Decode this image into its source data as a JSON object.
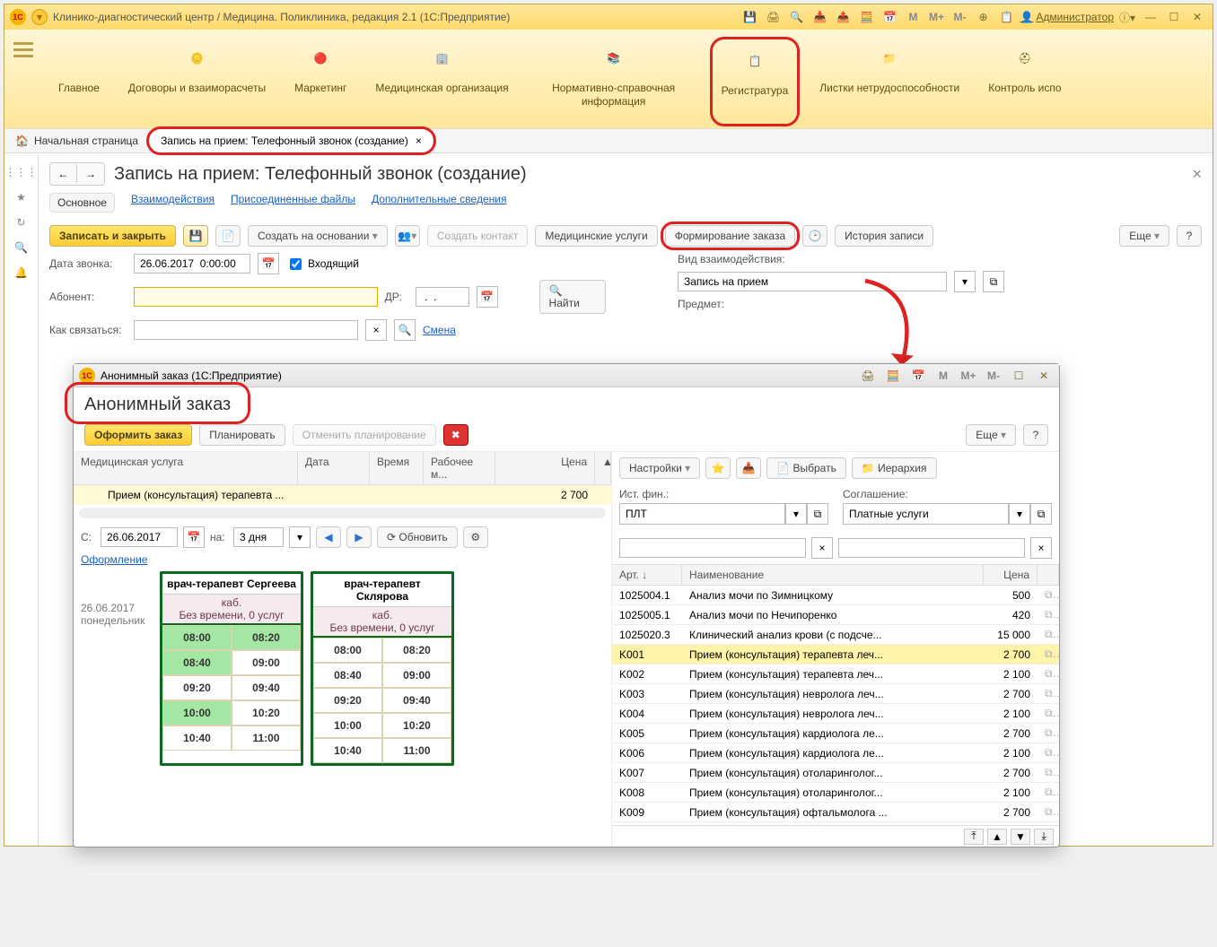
{
  "title": "Клинико-диагностический центр / Медицина. Поликлиника, редакция 2.1  (1С:Предприятие)",
  "admin": "Администратор",
  "nav": {
    "items": [
      {
        "label": "Главное"
      },
      {
        "label": "Договоры и взаиморасчеты"
      },
      {
        "label": "Маркетинг"
      },
      {
        "label": "Медицинская организация"
      },
      {
        "label": "Нормативно-справочная информация"
      },
      {
        "label": "Регистратура"
      },
      {
        "label": "Листки нетрудоспособности"
      },
      {
        "label": "Контроль испо"
      }
    ]
  },
  "tabs": {
    "home": "Начальная страница",
    "active": "Запись на прием: Телефонный звонок (создание)"
  },
  "page": {
    "title": "Запись на прием: Телефонный звонок (создание)",
    "links": {
      "main": "Основное",
      "interactions": "Взаимодействия",
      "files": "Присоединенные файлы",
      "extra": "Дополнительные сведения"
    },
    "buttons": {
      "save": "Записать и закрыть",
      "createBased": "Создать на основании",
      "createContact": "Создать контакт",
      "medServices": "Медицинские услуги",
      "formOrder": "Формирование заказа",
      "history": "История записи",
      "more": "Еще"
    },
    "fields": {
      "dateLabel": "Дата звонка:",
      "dateValue": "26.06.2017  0:00:00",
      "incoming": "Входящий",
      "abonentLabel": "Абонент:",
      "abonent": "",
      "drLabel": "ДР:",
      "drValue": " .  .   ",
      "findLabel": "Найти",
      "contactLabel": "Как связаться:",
      "smena": "Смена",
      "typeLabel": "Вид взаимодействия:",
      "typeValue": "Запись на прием",
      "subjectLabel": "Предмет:"
    }
  },
  "inner": {
    "title": "Анонимный заказ  (1С:Предприятие)",
    "heading": "Анонимный заказ",
    "buttons": {
      "submit": "Оформить заказ",
      "plan": "Планировать",
      "cancel": "Отменить планирование",
      "more": "Еще"
    },
    "grid": {
      "h1": "Медицинская услуга",
      "h2": "Дата",
      "h3": "Время",
      "h4": "Рабочее м...",
      "h5": "Цена",
      "row": {
        "name": "Прием (консультация) терапевта ...",
        "price": "2 700"
      }
    },
    "sched": {
      "cLabel": "С:",
      "cDate": "26.06.2017",
      "naLabel": "на:",
      "naVal": "3 дня",
      "refresh": "Обновить",
      "design": "Оформление",
      "day": "26.06.2017",
      "dayName": "понедельник",
      "doc1": "врач-терапевт Сергеева",
      "doc2": "врач-терапевт Склярова",
      "cabLine": "каб.",
      "statusLine": "Без времени, 0 услуг",
      "slots1": [
        [
          "08:00",
          "08:20"
        ],
        [
          "08:40",
          "09:00"
        ],
        [
          "09:20",
          "09:40"
        ],
        [
          "10:00",
          "10:20"
        ],
        [
          "10:40",
          "11:00"
        ]
      ],
      "slots1green": [
        "08:00",
        "08:20",
        "08:40",
        "10:00"
      ],
      "slots2": [
        [
          "08:00",
          "08:20"
        ],
        [
          "08:40",
          "09:00"
        ],
        [
          "09:20",
          "09:40"
        ],
        [
          "10:00",
          "10:20"
        ],
        [
          "10:40",
          "11:00"
        ]
      ]
    },
    "right": {
      "settings": "Настройки",
      "select": "Выбрать",
      "hierarchy": "Иерархия",
      "srcFinLabel": "Ист. фин.:",
      "srcFin": "ПЛТ",
      "agreeLabel": "Соглашение:",
      "agree": "Платные услуги",
      "cols": {
        "art": "Арт.",
        "name": "Наименование",
        "price": "Цена"
      },
      "rows": [
        {
          "art": "1025004.1",
          "name": "Анализ мочи по Зимницкому",
          "price": "500"
        },
        {
          "art": "1025005.1",
          "name": "Анализ мочи по Нечипоренко",
          "price": "420"
        },
        {
          "art": "1025020.3",
          "name": "Клинический анализ крови (с подсче...",
          "price": "15 000"
        },
        {
          "art": "K001",
          "name": "Прием (консультация) терапевта леч...",
          "price": "2 700",
          "sel": true
        },
        {
          "art": "K002",
          "name": "Прием (консультация) терапевта леч...",
          "price": "2 100"
        },
        {
          "art": "K003",
          "name": "Прием (консультация) невролога леч...",
          "price": "2 700"
        },
        {
          "art": "K004",
          "name": "Прием (консультация) невролога леч...",
          "price": "2 100"
        },
        {
          "art": "K005",
          "name": "Прием (консультация) кардиолога ле...",
          "price": "2 700"
        },
        {
          "art": "K006",
          "name": "Прием (консультация) кардиолога ле...",
          "price": "2 100"
        },
        {
          "art": "K007",
          "name": "Прием (консультация) отоларинголог...",
          "price": "2 700"
        },
        {
          "art": "K008",
          "name": "Прием (консультация) отоларинголог...",
          "price": "2 100"
        },
        {
          "art": "K009",
          "name": "Прием (консультация) офтальмолога ...",
          "price": "2 700"
        }
      ]
    }
  },
  "calc": {
    "m": "M",
    "mp": "M+",
    "mm": "M-"
  }
}
